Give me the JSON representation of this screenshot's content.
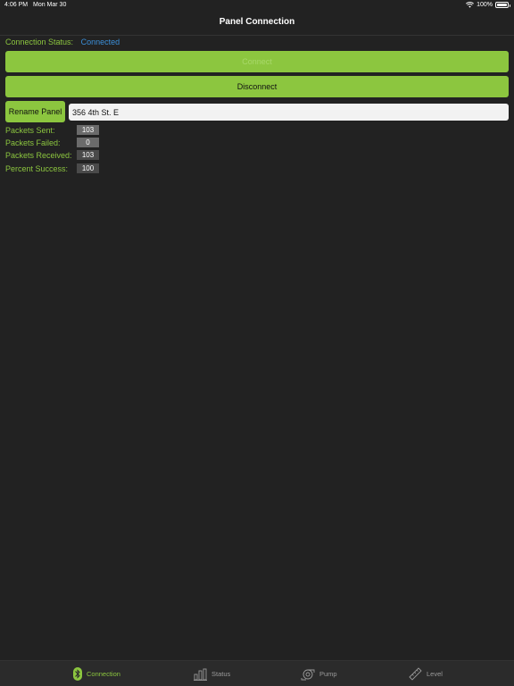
{
  "status_bar": {
    "time": "4:06 PM",
    "date": "Mon Mar 30",
    "battery": "100%"
  },
  "nav": {
    "title": "Panel Connection"
  },
  "connection": {
    "label": "Connection Status:",
    "value": "Connected"
  },
  "buttons": {
    "connect": "Connect",
    "disconnect": "Disconnect",
    "rename": "Rename Panel"
  },
  "panel_name": {
    "value": "356 4th St. E"
  },
  "stats": [
    {
      "label": "Packets Sent:",
      "value": "103"
    },
    {
      "label": "Packets Failed:",
      "value": "0"
    },
    {
      "label": "Packets Received:",
      "value": "103"
    },
    {
      "label": "Percent Success:",
      "value": "100"
    }
  ],
  "tabs": [
    {
      "label": "Connection",
      "icon": "bluetooth-icon",
      "active": true
    },
    {
      "label": "Status",
      "icon": "bar-chart-icon",
      "active": false
    },
    {
      "label": "Pump",
      "icon": "pump-icon",
      "active": false
    },
    {
      "label": "Level",
      "icon": "ruler-icon",
      "active": false
    }
  ],
  "colors": {
    "accent": "#8cc63f",
    "link": "#3b8fd9",
    "background": "#222222"
  }
}
